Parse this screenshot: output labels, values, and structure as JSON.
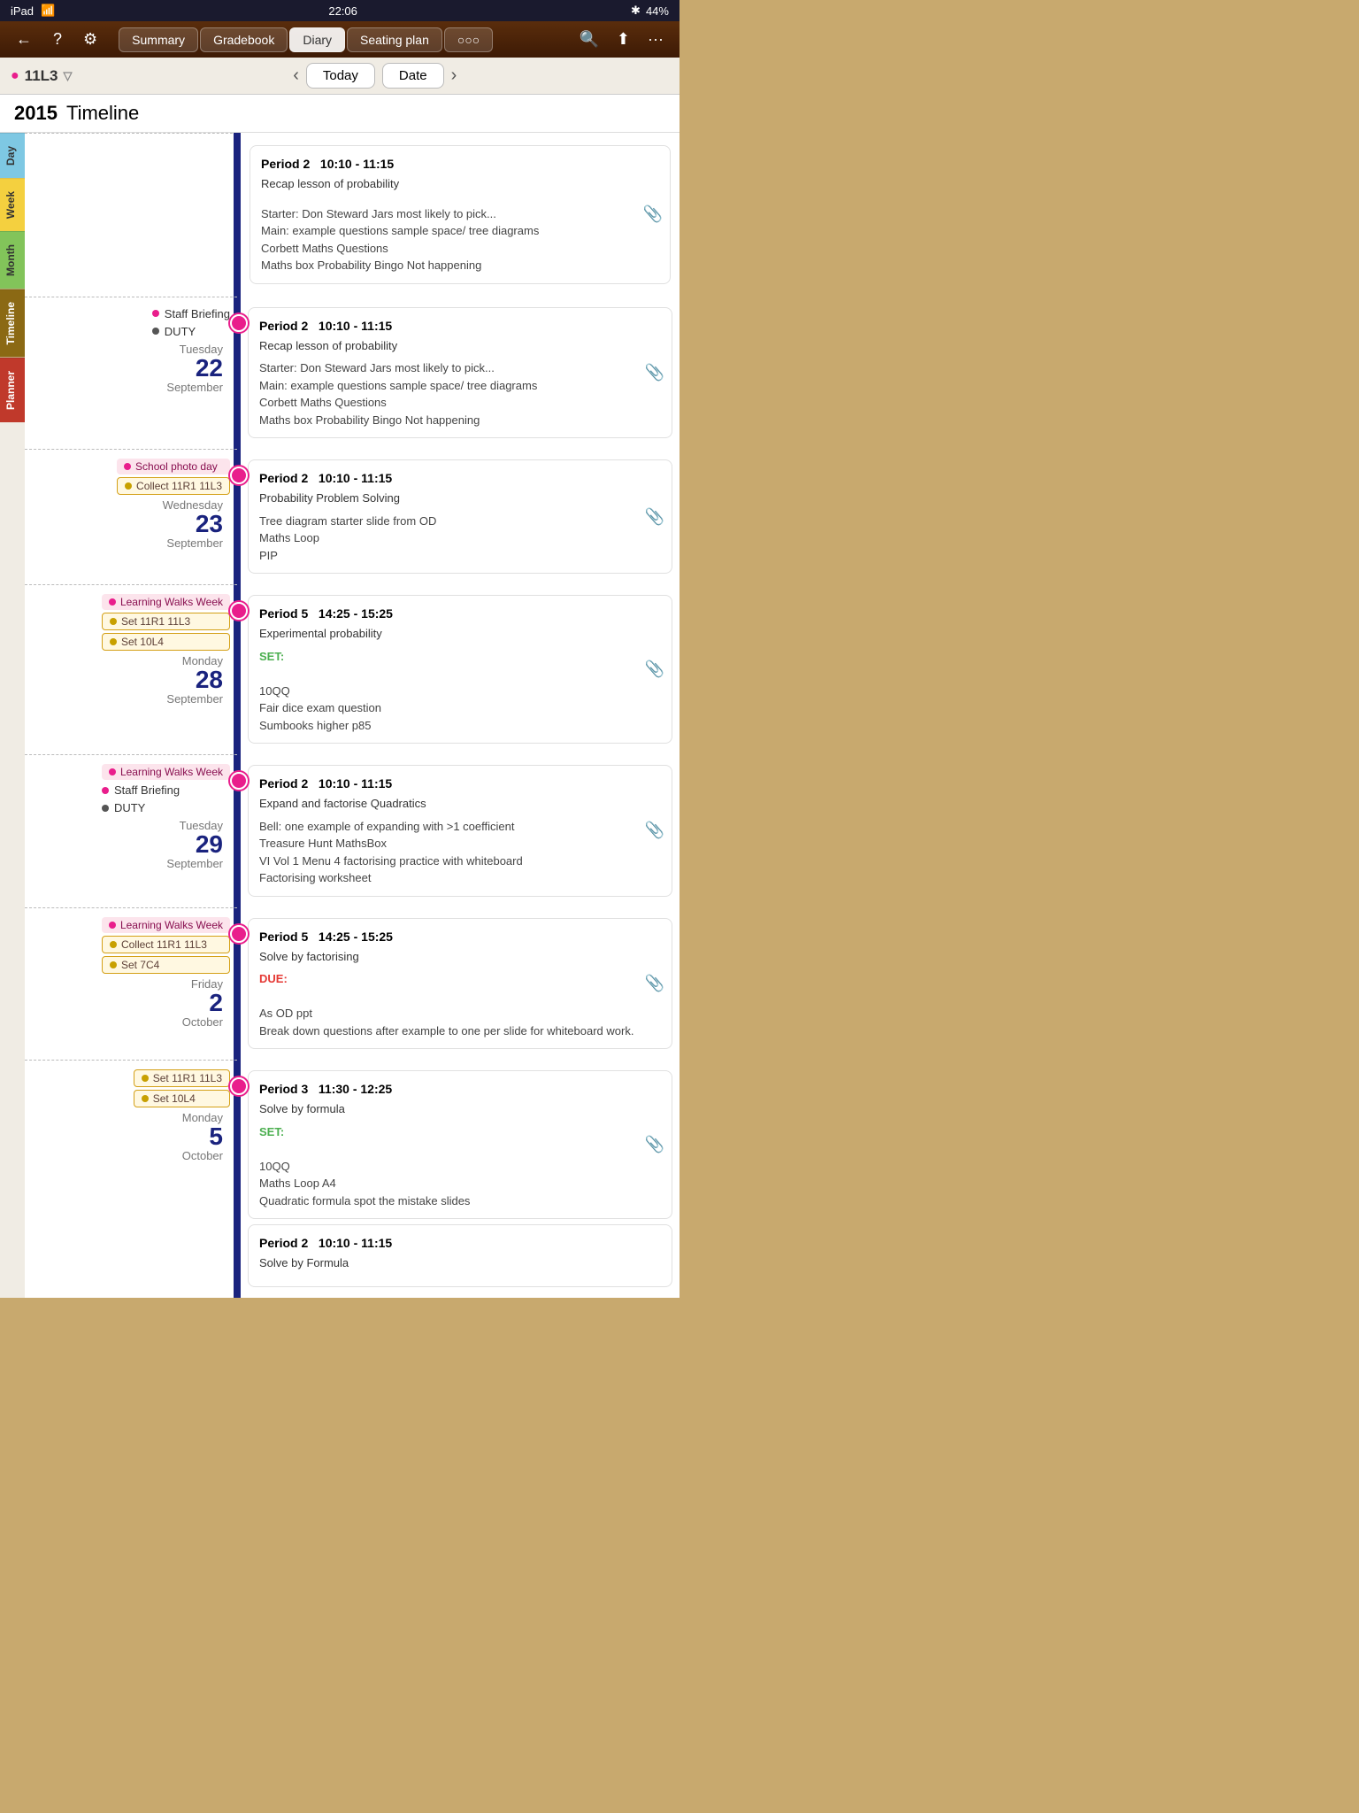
{
  "statusBar": {
    "left": "iPad",
    "wifi": "wifi",
    "time": "22:06",
    "bluetooth": "bluetooth",
    "battery": "44%"
  },
  "topNav": {
    "backLabel": "←",
    "helpLabel": "?",
    "settingsLabel": "⚙",
    "tabs": [
      "Summary",
      "Gradebook",
      "Diary",
      "Seating plan",
      "○○○"
    ],
    "activeTab": "Diary",
    "searchLabel": "🔍",
    "shareLabel": "↑",
    "moreLabel": "···"
  },
  "subNav": {
    "class": "11L3",
    "filterIcon": "▽",
    "prevLabel": "‹",
    "nextLabel": "›",
    "todayLabel": "Today",
    "dateLabel": "Date"
  },
  "yearTitle": {
    "year": "2015",
    "subtitle": "Timeline"
  },
  "sideTabs": [
    "Day",
    "Week",
    "Month",
    "Timeline",
    "Planner"
  ],
  "dates": [
    {
      "id": "sep22",
      "dayName": "Tuesday",
      "dayNum": "22",
      "monthName": "September",
      "tags": [
        {
          "type": "line",
          "dot": "pink",
          "label": "Staff Briefing"
        },
        {
          "type": "line",
          "dot": "dark",
          "label": "DUTY"
        }
      ],
      "entries": [
        {
          "id": "sep22-e1",
          "period": "Period 2",
          "time": "10:10 - 11:15",
          "title": "Recap lesson of probability",
          "body": "Starter: Don Steward Jars most likely to pick...\nMain: example questions sample space/ tree diagrams\nCorbett Maths Questions\nMaths box Probability Bingo Not happening",
          "hasClip": true,
          "setLabel": null,
          "dueLabel": null
        }
      ]
    },
    {
      "id": "sep23",
      "dayName": "Wednesday",
      "dayNum": "23",
      "monthName": "September",
      "tags": [
        {
          "type": "tag",
          "dot": "pink",
          "label": "School photo day"
        },
        {
          "type": "tag",
          "dot": "gold",
          "label": "Collect 11R1 11L3"
        }
      ],
      "entries": [
        {
          "id": "sep23-e1",
          "period": "Period 2",
          "time": "10:10 - 11:15",
          "title": "Probability Problem Solving",
          "body": "Tree diagram starter slide from OD\nMaths Loop\nPIP",
          "hasClip": true,
          "setLabel": null,
          "dueLabel": null
        }
      ]
    },
    {
      "id": "sep28",
      "dayName": "Monday",
      "dayNum": "28",
      "monthName": "September",
      "tags": [
        {
          "type": "tag",
          "dot": "pink",
          "label": "Learning Walks Week"
        },
        {
          "type": "tag",
          "dot": "gold",
          "label": "Set 11R1 11L3"
        },
        {
          "type": "tag",
          "dot": "gold",
          "label": "Set 10L4"
        }
      ],
      "entries": [
        {
          "id": "sep28-e1",
          "period": "Period 5",
          "time": "14:25 - 15:25",
          "title": "Experimental probability",
          "body": "SET:\n\n10QQ\nFair dice exam question\nSumbooks higher p85",
          "hasClip": true,
          "setLabel": "SET:",
          "dueLabel": null
        }
      ]
    },
    {
      "id": "sep29",
      "dayName": "Tuesday",
      "dayNum": "29",
      "monthName": "September",
      "tags": [
        {
          "type": "tag",
          "dot": "pink",
          "label": "Learning Walks Week"
        },
        {
          "type": "line",
          "dot": "pink",
          "label": "Staff Briefing"
        },
        {
          "type": "line",
          "dot": "dark",
          "label": "DUTY"
        }
      ],
      "entries": [
        {
          "id": "sep29-e1",
          "period": "Period 2",
          "time": "10:10 - 11:15",
          "title": "Expand and factorise Quadratics",
          "body": "Bell: one example of expanding with >1 coefficient\nTreasure Hunt MathsBox\nVI Vol 1 Menu 4 factorising practice with whiteboard\nFactorising worksheet",
          "hasClip": true,
          "setLabel": null,
          "dueLabel": null
        }
      ]
    },
    {
      "id": "oct2",
      "dayName": "Friday",
      "dayNum": "2",
      "monthName": "October",
      "tags": [
        {
          "type": "tag",
          "dot": "pink",
          "label": "Learning Walks Week"
        },
        {
          "type": "tag",
          "dot": "gold",
          "label": "Collect 11R1 11L3"
        },
        {
          "type": "tag",
          "dot": "gold",
          "label": "Set 7C4"
        }
      ],
      "entries": [
        {
          "id": "oct2-e1",
          "period": "Period 5",
          "time": "14:25 - 15:25",
          "title": "Solve by factorising",
          "body": "DUE:\n\nAs OD ppt\nBreak down questions after example to one per slide for whiteboard work.",
          "hasClip": true,
          "setLabel": null,
          "dueLabel": "DUE:"
        }
      ]
    },
    {
      "id": "oct5",
      "dayName": "Monday",
      "dayNum": "5",
      "monthName": "October",
      "tags": [
        {
          "type": "tag",
          "dot": "gold",
          "label": "Set 11R1 11L3"
        },
        {
          "type": "tag",
          "dot": "gold",
          "label": "Set 10L4"
        }
      ],
      "entries": [
        {
          "id": "oct5-e1",
          "period": "Period 3",
          "time": "11:30 - 12:25",
          "title": "Solve by formula",
          "body": "SET:\n\n10QQ\nMaths Loop A4\nQuadratic formula spot the mistake slides",
          "hasClip": true,
          "setLabel": "SET:",
          "dueLabel": null
        },
        {
          "id": "oct5-e2",
          "period": "Period 2",
          "time": "10:10 - 11:15",
          "title": "Solve by Formula",
          "body": "",
          "hasClip": false,
          "setLabel": null,
          "dueLabel": null
        }
      ]
    }
  ]
}
